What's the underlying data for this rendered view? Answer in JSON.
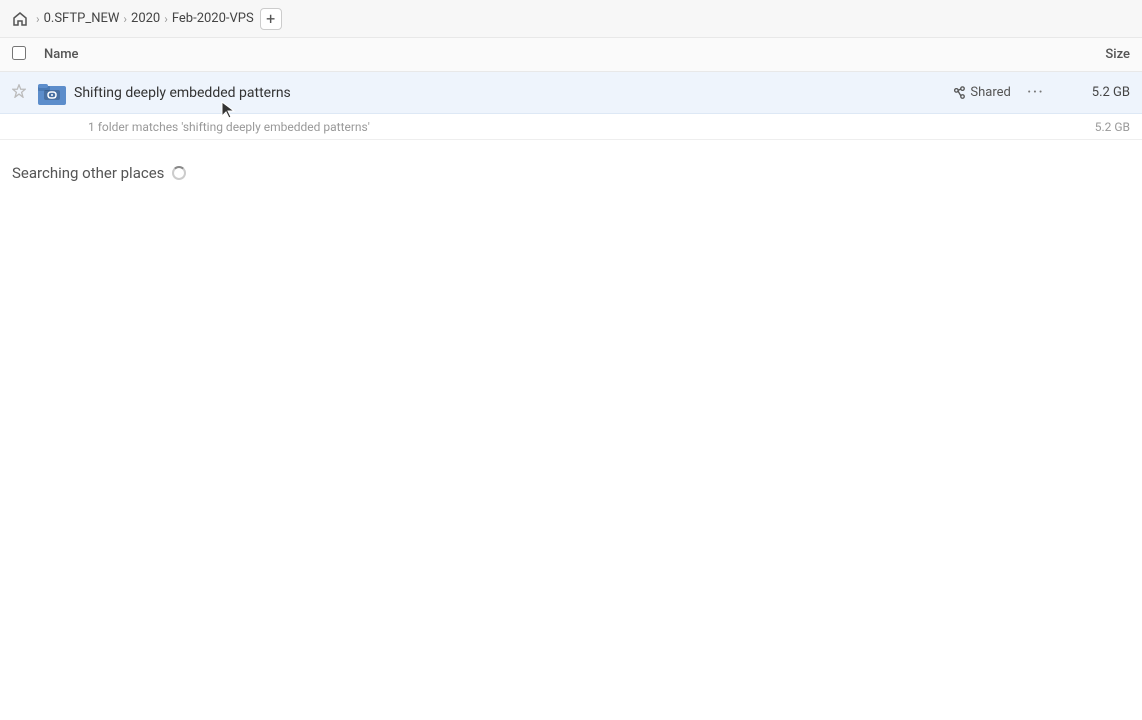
{
  "breadcrumb": {
    "home_icon": "home",
    "items": [
      {
        "label": "0.SFTP_NEW"
      },
      {
        "label": "2020"
      },
      {
        "label": "Feb-2020-VPS"
      }
    ],
    "add_button": "+"
  },
  "columns": {
    "name_label": "Name",
    "size_label": "Size"
  },
  "file_row": {
    "folder_name": "Shifting deeply embedded patterns",
    "shared_label": "Shared",
    "more_icon": "···",
    "size": "5.2 GB"
  },
  "match_info": {
    "text": "1 folder matches 'shifting deeply embedded patterns'",
    "size": "5.2 GB"
  },
  "searching_section": {
    "title": "Searching other places"
  }
}
